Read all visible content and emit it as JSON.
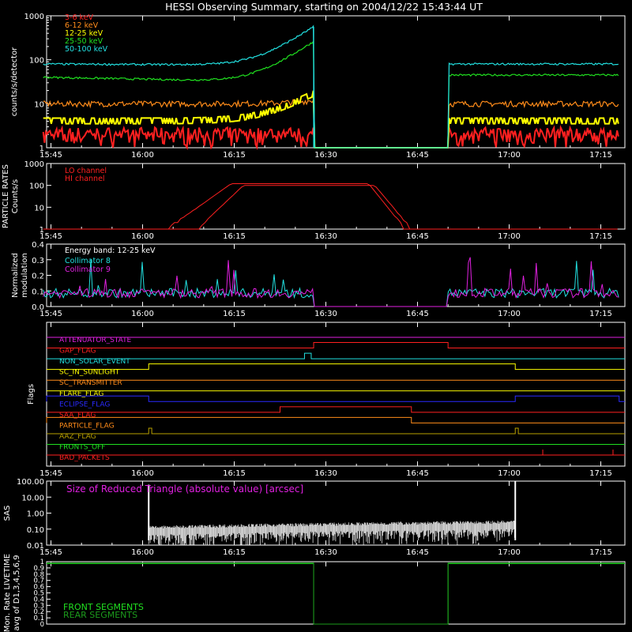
{
  "title": "HESSI Observing Summary, starting on 2004/12/22 15:43:44 UT",
  "time_ticks": [
    "15:45",
    "16:00",
    "16:15",
    "16:30",
    "16:45",
    "17:00",
    "17:15"
  ],
  "colors": {
    "red": "#ff2020",
    "orange": "#ff8c1a",
    "yellow": "#ffff00",
    "green": "#20e020",
    "cyan": "#22e0e0",
    "magenta": "#e020e0",
    "blue": "#2a2aff",
    "olive": "#b8a000",
    "white": "#ffffff"
  },
  "chart_data": [
    {
      "type": "line",
      "panel": "count-rates",
      "ylabel": "counts/s/detector",
      "yscale": "log",
      "ylim": [
        1,
        1000
      ],
      "y_ticks": [
        "1",
        "10",
        "100",
        "1000"
      ],
      "x_domain_minutes": [
        -1.27,
        93.0
      ],
      "data_gap_minutes": [
        43.0,
        65.0
      ],
      "series": [
        {
          "name": "3-6 keV",
          "color": "red",
          "base": 1.8,
          "noise": 1.3,
          "before_end": 2.0,
          "flat_after": true
        },
        {
          "name": "6-12 keV",
          "color": "orange",
          "base": 10,
          "noise": 0.15,
          "before_end": 12,
          "flat_after": true
        },
        {
          "name": "12-25 keV",
          "color": "yellow",
          "base": 4.5,
          "noise": 0.3,
          "before_end": 13,
          "flat_after": true
        },
        {
          "name": "25-50 keV",
          "color": "green",
          "base": 30,
          "noise": 0.05,
          "start": 40,
          "before_end": 260,
          "after": 45
        },
        {
          "name": "50-100 keV",
          "color": "cyan",
          "base": 75,
          "noise": 0.05,
          "start": 80,
          "before_end": 560,
          "after": 80
        }
      ]
    },
    {
      "type": "line",
      "panel": "particle-rates",
      "ylabel": "PARTICLE RATES",
      "ylabel2": "Counts/s",
      "yscale": "log",
      "ylim": [
        1,
        1000
      ],
      "y_ticks": [
        "1",
        "10",
        "100",
        "1000"
      ],
      "series": [
        {
          "name": "LO channel",
          "color": "red",
          "rise": [
            19,
            44
          ],
          "plateau": 120
        },
        {
          "name": "HI channel",
          "color": "red",
          "rise": [
            24,
            43
          ],
          "plateau": 100
        }
      ]
    },
    {
      "type": "line",
      "panel": "modulation",
      "ylabel": "Normalized",
      "ylabel2": "modulation",
      "ylim": [
        0,
        0.4
      ],
      "y_ticks": [
        "0.0",
        "0.1",
        "0.2",
        "0.3",
        "0.4"
      ],
      "annotation": "Energy band: 12-25 keV",
      "series": [
        {
          "name": "Collimator 8",
          "color": "cyan"
        },
        {
          "name": "Collimator 9",
          "color": "magenta"
        }
      ]
    },
    {
      "type": "line",
      "panel": "flags",
      "ylabel": "Flags",
      "flags": [
        {
          "label": "ATTENUATOR_STATE",
          "color": "magenta",
          "high": []
        },
        {
          "label": "GAP_FLAG",
          "color": "red",
          "high": [
            [
              43.0,
              65.0
            ]
          ]
        },
        {
          "label": "NON_SOLAR_EVENT",
          "color": "cyan",
          "high": [
            [
              41.5,
              42.6
            ]
          ]
        },
        {
          "label": "SC_IN_SUNLIGHT",
          "color": "yellow",
          "high": [
            [
              16.0,
              76.0
            ]
          ]
        },
        {
          "label": "SC_TRANSMITTER",
          "color": "orange",
          "high": []
        },
        {
          "label": "FLARE_FLAG",
          "color": "yellow",
          "high": []
        },
        {
          "label": "ECLIPSE_FLAG",
          "color": "blue",
          "high": [
            [
              -1.3,
              16.0
            ],
            [
              76.0,
              93.0
            ]
          ]
        },
        {
          "label": "SAA_FLAG",
          "color": "red",
          "high": [
            [
              37.5,
              59.0
            ]
          ]
        },
        {
          "label": "PARTICLE_FLAG",
          "color": "orange",
          "high": [
            [
              -1.3,
              59.0
            ]
          ]
        },
        {
          "label": "AAZ_FLAG",
          "color": "olive",
          "high": [
            [
              16.0,
              16.5
            ],
            [
              76.0,
              76.5
            ]
          ]
        },
        {
          "label": "FRONTS_OFF",
          "color": "green",
          "high": []
        },
        {
          "label": "BAD_PACKETS",
          "color": "red",
          "spikes": [
            80.5,
            92.0
          ]
        }
      ]
    },
    {
      "type": "line",
      "panel": "sas",
      "ylabel": "SAS",
      "yscale": "log",
      "ylim": [
        0.01,
        100
      ],
      "y_ticks": [
        "0.01",
        "0.10",
        "1.00",
        "10.00",
        "100.00"
      ],
      "annotation": "Size of Reduced Triangle (absolute value) [arcsec]",
      "series": [
        {
          "color": "white",
          "active": [
            16.0,
            76.0
          ],
          "base": 0.12
        }
      ]
    },
    {
      "type": "line",
      "panel": "livetime",
      "ylabel": "Mon. Rate LIVETIME",
      "ylabel2": "avg of D1,3,4,5,6,9",
      "ylim": [
        0,
        1.0
      ],
      "y_ticks": [
        "0",
        "0.1",
        "0.2",
        "0.3",
        "0.4",
        "0.5",
        "0.6",
        "0.7",
        "0.8",
        "0.9",
        "1"
      ],
      "series": [
        {
          "name": "FRONT SEGMENTS",
          "color": "green",
          "level": 0.97
        },
        {
          "name": "REAR SEGMENTS",
          "color": "#1c9c1c",
          "level": 0.98
        }
      ]
    }
  ]
}
